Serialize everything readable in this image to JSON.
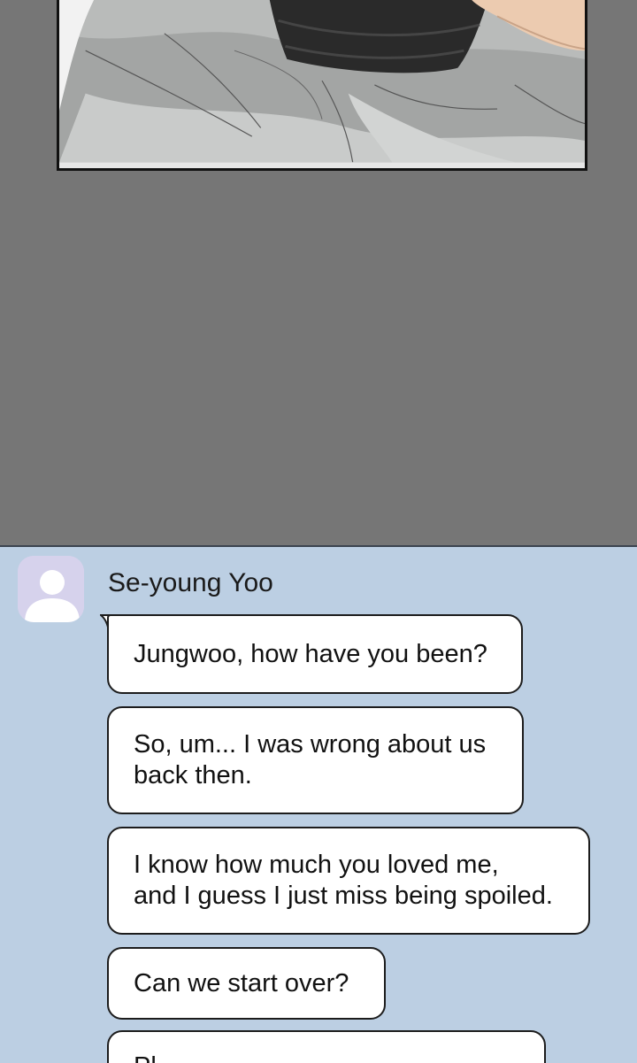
{
  "chat": {
    "sender_name": "Se-young Yoo",
    "avatar_icon": "default-user-avatar-icon",
    "messages": [
      {
        "text": "Jungwoo, how have you been?"
      },
      {
        "text": "So, um... I was wrong about us\nback then."
      },
      {
        "text": "I know how much you loved me,\nand I guess I just miss being spoiled."
      },
      {
        "text": "Can we start over?"
      },
      {
        "text": "Pl"
      }
    ]
  },
  "colors": {
    "page_background": "#767676",
    "chat_background": "#bccfe3",
    "avatar_background": "#d6d2ec",
    "bubble_background": "#ffffff",
    "bubble_border": "#1c1c1c"
  }
}
